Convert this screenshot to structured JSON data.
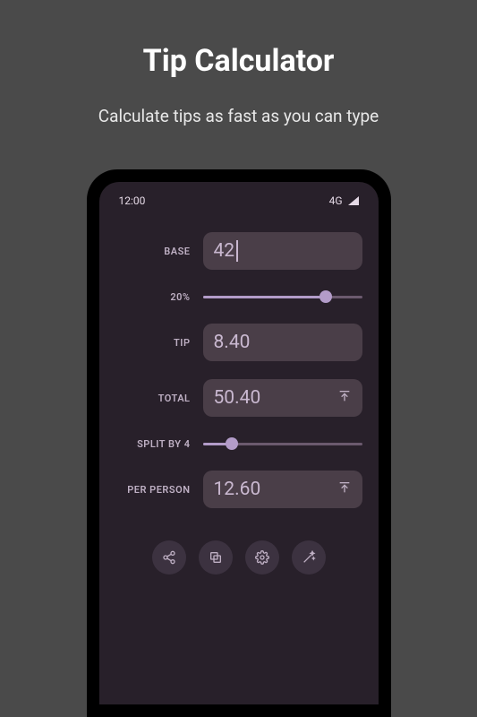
{
  "header": {
    "title": "Tip Calculator",
    "subtitle": "Calculate tips as fast as you can type"
  },
  "status": {
    "time": "12:00",
    "network": "4G"
  },
  "labels": {
    "base": "BASE",
    "tip": "TIP",
    "total": "TOTAL",
    "perPerson": "PER PERSON"
  },
  "values": {
    "base": "42",
    "tipPercent": "20%",
    "tip": "8.40",
    "total": "50.40",
    "split": "SPLIT BY 4",
    "perPerson": "12.60"
  },
  "sliders": {
    "tipPercent": 77,
    "split": 18
  }
}
